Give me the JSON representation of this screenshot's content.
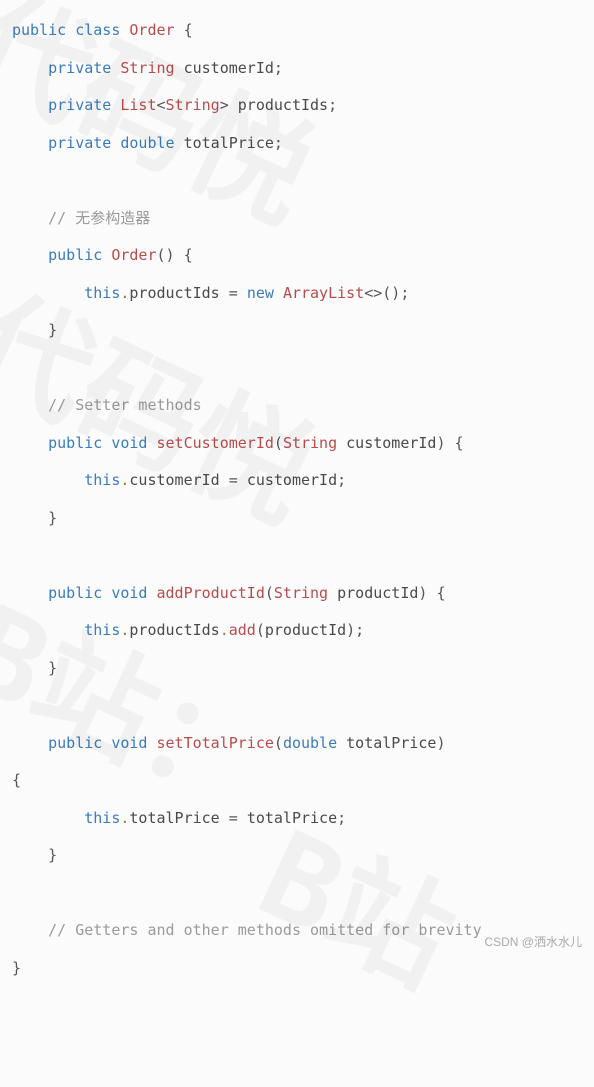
{
  "code": {
    "l1": {
      "kw1": "public",
      "kw2": "class",
      "type": "Order",
      "brace": "{"
    },
    "l2": {
      "kw": "private",
      "type": "String",
      "id": "customerId",
      "semi": ";"
    },
    "l3": {
      "kw": "private",
      "type1": "List",
      "lt": "<",
      "type2": "String",
      "gt": ">",
      "id": "productIds",
      "semi": ";"
    },
    "l4": {
      "kw": "private",
      "kw2": "double",
      "id": "totalPrice",
      "semi": ";"
    },
    "c1": "// 无参构造器",
    "l5": {
      "kw": "public",
      "fn": "Order",
      "p": "() {"
    },
    "l6": {
      "this": "this",
      "dot": ".",
      "id": "productIds",
      "eq": " = ",
      "kw": "new",
      "sp": " ",
      "type": "ArrayList",
      "gen": "<>",
      "p": "();"
    },
    "rb1": "}",
    "c2": "// Setter methods",
    "l7": {
      "kw": "public",
      "kw2": "void",
      "fn": "setCustomerId",
      "lp": "(",
      "type": "String",
      "arg": "customerId",
      "rp": ") {"
    },
    "l8": {
      "this": "this",
      "dot": ".",
      "id": "customerId",
      "eq": " = ",
      "rhs": "customerId",
      "semi": ";"
    },
    "rb2": "}",
    "l9": {
      "kw": "public",
      "kw2": "void",
      "fn": "addProductId",
      "lp": "(",
      "type": "String",
      "arg": "productId",
      "rp": ") {"
    },
    "l10": {
      "this": "this",
      "dot1": ".",
      "id": "productIds",
      "dot2": ".",
      "fn": "add",
      "lp": "(",
      "arg": "productId",
      "rp": ");"
    },
    "rb3": "}",
    "l11": {
      "kw": "public",
      "kw2": "void",
      "fn": "setTotalPrice",
      "lp": "(",
      "ptype": "double",
      "arg": "totalPrice",
      "rp": ") "
    },
    "lb11": "{",
    "l12": {
      "this": "this",
      "dot": ".",
      "id": "totalPrice",
      "eq": " = ",
      "rhs": "totalPrice",
      "semi": ";"
    },
    "rb4": "}",
    "c3": "// Getters and other methods omitted for brevity",
    "rb5": "}"
  },
  "footer": "CSDN @洒水水儿"
}
